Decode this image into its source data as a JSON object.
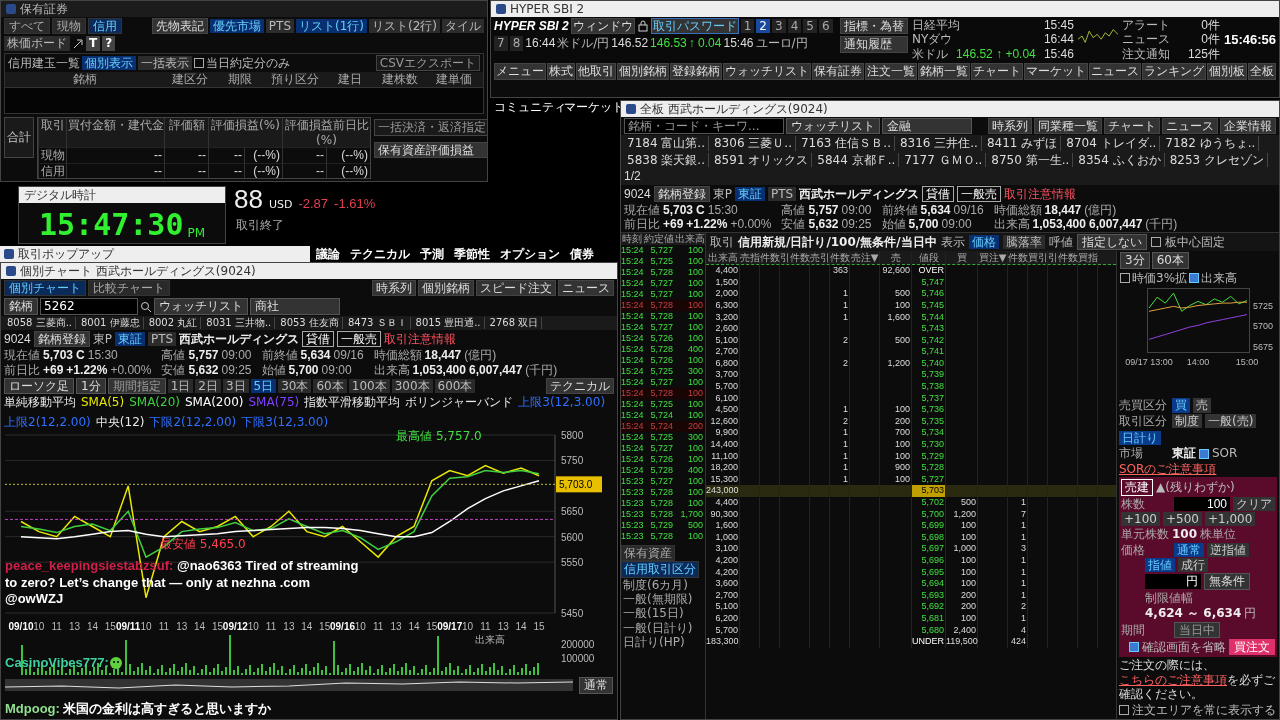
{
  "holdings_window": {
    "title": "保有証券",
    "tabs": [
      {
        "label": "すべて",
        "selected": false
      },
      {
        "label": "現物",
        "selected": false
      },
      {
        "label": "信用",
        "selected": true
      }
    ],
    "plain_buttons": [
      "先物表記"
    ],
    "market_toggle": [
      {
        "label": "優先市場",
        "selected": true
      },
      {
        "label": "PTS",
        "selected": false
      }
    ],
    "view_toggle": [
      {
        "label": "リスト(1行)",
        "selected": true
      },
      {
        "label": "リスト(2行)",
        "selected": false
      },
      {
        "label": "タイル",
        "selected": false
      },
      {
        "label": "株価ボード",
        "selected": false
      }
    ],
    "icon_chars": [
      "T",
      "?"
    ],
    "list_title": "信用建玉一覧",
    "display_toggle": [
      {
        "label": "個別表示",
        "selected": true
      },
      {
        "label": "一括表示",
        "selected": false
      }
    ],
    "today_only": {
      "label": "当日約定分のみ",
      "checked": false
    },
    "export_button": {
      "label": "CSVエクスポート",
      "disabled": true
    },
    "columns": [
      "銘柄",
      "建区分",
      "期限",
      "預り区分",
      "建日",
      "建株数",
      "建単価"
    ],
    "summary": {
      "label": "合計",
      "headers": [
        "取引",
        "買付金額・建代金",
        "評価額",
        "評価損益(%)",
        "評価損益前日比(%)"
      ],
      "rows": [
        {
          "name": "現物",
          "cells": [
            "--",
            "--",
            "--",
            "(--%)",
            "--",
            "(--%)"
          ]
        },
        {
          "name": "信用",
          "cells": [
            "--",
            "--",
            "--",
            "(--%)",
            "--",
            "(--%)"
          ]
        }
      ]
    },
    "side_buttons": [
      {
        "label": "一括決済・返済指定",
        "disabled": true
      },
      {
        "label": "保有資産評価損益",
        "disabled": false
      }
    ]
  },
  "main_bar": {
    "title": "HYPER SBI 2",
    "logo": "HYPER SBI 2",
    "window_menu": "ウィンドウ",
    "password_button": "取引パスワード",
    "workspaces": [
      {
        "label": "1",
        "selected": false
      },
      {
        "label": "2",
        "selected": true
      },
      {
        "label": "3",
        "selected": false
      },
      {
        "label": "4",
        "selected": false
      },
      {
        "label": "5",
        "selected": false
      },
      {
        "label": "6",
        "selected": false
      },
      {
        "label": "7",
        "selected": false
      },
      {
        "label": "8",
        "selected": false
      }
    ],
    "quotes": [
      {
        "texts": [
          "16:44"
        ]
      },
      {
        "name": "米ドル/円",
        "texts": [
          "146.52",
          "146.53",
          "↑ 0.04",
          "15:46"
        ]
      },
      {
        "name": "ユーロ/円"
      }
    ],
    "side_buttons": [
      "指標・為替",
      "通知履歴"
    ],
    "indices": [
      {
        "name": "日経平均",
        "time": "15:45"
      },
      {
        "name": "NYダウ",
        "time": "16:44"
      },
      {
        "name": "米ドル",
        "value": "146.52 ↑ +0.04",
        "time": "15:46"
      }
    ],
    "notices": [
      {
        "label": "アラート",
        "count": "0件"
      },
      {
        "label": "ニュース",
        "count": "0件"
      },
      {
        "label": "注文通知",
        "count": "125件"
      }
    ],
    "clock": "15:46:56",
    "menu": [
      "メニュー",
      "株式",
      "他取引",
      "個別銘柄",
      "登録銘柄",
      "ウォッチリスト",
      "保有証券",
      "注文一覧",
      "銘柄一覧",
      "チャート",
      "マーケット",
      "ニュース",
      "ランキング",
      "個別板",
      "全板"
    ]
  },
  "background": {
    "nav": [
      "コミュニティ",
      "マーケット"
    ],
    "price": "88",
    "currency": "USD",
    "change": "-2.87",
    "change_pct": "-1.61%",
    "status": "取引終了",
    "tabs": [
      "議論",
      "テクニカル",
      "予測",
      "季節性",
      "オプション",
      "債券"
    ]
  },
  "clock_window": {
    "title": "デジタル時計",
    "time": "15:47:30",
    "ampm": "PM"
  },
  "popup_window": {
    "title": "取引ポップアップ"
  },
  "chart_window": {
    "title": "個別チャート 西武ホールディングス(9024)",
    "tabs": [
      {
        "label": "個別チャート",
        "selected": true
      },
      {
        "label": "比較チャート",
        "selected": false
      }
    ],
    "buttons": [
      "時系列",
      "個別銘柄",
      "スピード注文",
      "ニュース"
    ],
    "search": {
      "type_select": "銘柄",
      "value": "5262",
      "watchlist": "ウォッチリスト",
      "list": "商社"
    },
    "tickers": [
      "8058 三菱商..",
      "8001 伊藤忠",
      "8002 丸紅",
      "8031 三井物..",
      "8053 住友商",
      "8473 ＳＢＩ",
      "8015 豊田通..",
      "2768 双日"
    ],
    "info": {
      "code": "9024",
      "register": "銘柄登録",
      "market": "東P",
      "name": "西武ホールディングス",
      "venues": [
        {
          "label": "東証",
          "selected": true
        },
        {
          "label": "PTS",
          "selected": false
        }
      ],
      "tags": [
        "貸借",
        "一般売"
      ],
      "warning": "取引注意情報",
      "fields": [
        {
          "label": "現在値",
          "value": "5,703",
          "extra": "C",
          "time": "15:30"
        },
        {
          "label": "前日比",
          "value": "+69",
          "extra": "+1.22%",
          "time": "+0.00%"
        },
        {
          "label": "高値",
          "value": "5,757",
          "time": "09:00"
        },
        {
          "label": "安値",
          "value": "5,632",
          "time": "09:25"
        },
        {
          "label": "前終値",
          "value": "5,634",
          "time": "09/16"
        },
        {
          "label": "始値",
          "value": "5,700",
          "time": "09:00"
        },
        {
          "label": "時価総額",
          "value": "18,447",
          "time": "(億円)"
        },
        {
          "label": "出来高",
          "value": "1,053,400",
          "extra": "6,007,447",
          "time": "(千円)"
        }
      ]
    },
    "controls": {
      "chart_type": "ローソク足",
      "interval": "1分",
      "range": "期間指定",
      "periods": [
        {
          "label": "1日",
          "selected": false
        },
        {
          "label": "2日",
          "selected": false
        },
        {
          "label": "3日",
          "selected": false
        },
        {
          "label": "5日",
          "selected": true
        },
        {
          "label": "30本",
          "selected": false
        },
        {
          "label": "60本",
          "selected": false
        },
        {
          "label": "100本",
          "selected": false
        },
        {
          "label": "300本",
          "selected": false
        },
        {
          "label": "600本",
          "selected": false
        }
      ],
      "technical": "テクニカル"
    },
    "legend": [
      {
        "label": "単純移動平均"
      },
      {
        "label": "SMA(75)",
        "color": "#8040ff"
      },
      {
        "label": "指数平滑移動平均"
      },
      {
        "label": "ボリンジャーバンド"
      },
      {
        "label": "上限3(12,3.00)",
        "color": "#3070ff"
      },
      {
        "label": "上限2(12,2.00)",
        "color": "#3070ff"
      },
      {
        "label": "中央(12)"
      },
      {
        "label": "下限2(12,2.00)",
        "color": "#3070ff"
      },
      {
        "label": "下限3(12,3.00)",
        "color": "#3070ff"
      }
    ],
    "annotations": {
      "high": "最高値 5,757.0",
      "price_tag": "5,703.0",
      "low": "最安値 5,465.0"
    },
    "chart_data": {
      "type": "line",
      "grid": true,
      "categories": [
        "09/10",
        "10",
        "11",
        "13",
        "14",
        "15",
        "09/11",
        "10",
        "11",
        "13",
        "14",
        "15",
        "09/12",
        "10",
        "11",
        "13",
        "14",
        "15",
        "09/16",
        "10",
        "11",
        "13",
        "14",
        "15",
        "09/17",
        "10",
        "11",
        "13",
        "14",
        "15"
      ],
      "ylim": [
        5450,
        5800
      ],
      "yticks": [
        5450,
        5550,
        5600,
        5650,
        5750,
        5800
      ],
      "series": [
        {
          "name": "SMA(5)",
          "color": "#e8e800",
          "values": [
            5630,
            5610,
            5600,
            5640,
            5620,
            5600,
            5700,
            5480,
            5600,
            5630,
            5610,
            5620,
            5640,
            5600,
            5620,
            5650,
            5610,
            5600,
            5620,
            5590,
            5560,
            5600,
            5620,
            5710,
            5730,
            5720,
            5740,
            5725,
            5735,
            5720
          ]
        },
        {
          "name": "SMA(20)",
          "color": "#40d040",
          "values": [
            5620,
            5615,
            5608,
            5620,
            5625,
            5612,
            5650,
            5560,
            5580,
            5610,
            5615,
            5618,
            5628,
            5612,
            5616,
            5635,
            5620,
            5606,
            5612,
            5598,
            5575,
            5590,
            5610,
            5680,
            5715,
            5718,
            5730,
            5726,
            5730,
            5724
          ]
        },
        {
          "name": "SMA(200)",
          "color": "#ffffff",
          "values": [
            5600,
            5598,
            5596,
            5600,
            5605,
            5610,
            5612,
            5605,
            5600,
            5602,
            5604,
            5606,
            5610,
            5612,
            5614,
            5616,
            5618,
            5618,
            5616,
            5612,
            5606,
            5600,
            5600,
            5608,
            5630,
            5655,
            5675,
            5690,
            5700,
            5710
          ]
        }
      ]
    },
    "volume": {
      "label": "出来高",
      "ticks": [
        "200000",
        "100000"
      ]
    },
    "display_select": "通常"
  },
  "chat": [
    {
      "kind": "text",
      "user": "peace_keepingsiestabzsuf:",
      "color": "#d0204a",
      "text": "@nao6363 Tired of streaming to zero? Let’s change that — only at nezhna .com @owWZJ"
    },
    {
      "kind": "emote",
      "user": "CasinoVibes777:",
      "color": "#40d0a0"
    },
    {
      "kind": "text",
      "user": "Mdpoog:",
      "color": "#90e090",
      "text": "米国の金利は高すぎると思いますか"
    }
  ],
  "board_window": {
    "title": "全板 西武ホールディングス(9024)",
    "search": {
      "placeholder": "銘柄・コード・キーワ...",
      "watchlist": "ウォッチリスト",
      "list": "金融"
    },
    "buttons": [
      "時系列",
      "同業種一覧",
      "チャート",
      "ニュース",
      "企業情報"
    ],
    "tickers": [
      "7184 富山第..",
      "8306 三菱Ｕ..",
      "7163 住信ＳＢ..",
      "8316 三井住..",
      "8411 みずほ",
      "8704 トレイダ..",
      "7182 ゆうちょ..",
      "5838 楽天銀..",
      "8591 オリックス",
      "5844 京都Ｆ..",
      "7177 ＧＭＯ..",
      "8750 第一生..",
      "8354 ふくおか",
      "8253 クレセゾン"
    ],
    "page": "1/2",
    "info": {
      "code": "9024",
      "register": "銘柄登録",
      "market": "東P",
      "name": "西武ホールディングス",
      "venues": [
        {
          "label": "東証",
          "selected": true
        },
        {
          "label": "PTS",
          "selected": false
        }
      ],
      "tags": [
        "貸借",
        "一般売"
      ],
      "warning": "取引注意情報",
      "fields": [
        {
          "label": "現在値",
          "value": "5,703",
          "extra": "C",
          "time": "15:30"
        },
        {
          "label": "前日比",
          "value": "+69",
          "extra": "+1.22%",
          "time": "+0.00%"
        },
        {
          "label": "高値",
          "value": "5,757",
          "time": "09:00"
        },
        {
          "label": "安値",
          "value": "5,632",
          "time": "09:25"
        },
        {
          "label": "前終値",
          "value": "5,634",
          "time": "09/16"
        },
        {
          "label": "始値",
          "value": "5,700",
          "time": "09:00"
        },
        {
          "label": "時価総額",
          "value": "18,447",
          "time": "(億円)"
        },
        {
          "label": "出来高",
          "value": "1,053,400",
          "extra": "6,007,447",
          "time": "(千円)"
        }
      ]
    },
    "order_bar": {
      "trade_label": "取引",
      "trade": "信用新規/日計り/100/無条件/当日中",
      "display_label": "表示",
      "display": [
        {
          "label": "価格",
          "selected": true
        },
        {
          "label": "騰落率",
          "selected": false
        }
      ],
      "tick_label": "呼値",
      "tick": "指定しない",
      "center_fix": {
        "label": "板中心固定",
        "checked": false
      }
    },
    "ticks_headers": [
      "時刻",
      "約定値",
      "出来高"
    ],
    "ticks": [
      {
        "time": "15:24",
        "price": "5,727",
        "qty": "100",
        "dimmed": false
      },
      {
        "time": "15:24",
        "price": "5,725",
        "qty": "100",
        "dimmed": false
      },
      {
        "time": "15:24",
        "price": "5,728",
        "qty": "100",
        "dimmed": false
      },
      {
        "time": "15:24",
        "price": "5,727",
        "qty": "100",
        "dimmed": false
      },
      {
        "time": "15:24",
        "price": "5,727",
        "qty": "100",
        "dimmed": false
      },
      {
        "time": "15:24",
        "price": "5,728",
        "qty": "100",
        "dimmed": true
      },
      {
        "time": "15:24",
        "price": "5,728",
        "qty": "100",
        "dimmed": false
      },
      {
        "time": "15:24",
        "price": "5,727",
        "qty": "100",
        "dimmed": false
      },
      {
        "time": "15:24",
        "price": "5,726",
        "qty": "100",
        "dimmed": false
      },
      {
        "time": "15:24",
        "price": "5,728",
        "qty": "400",
        "dimmed": false
      },
      {
        "time": "15:24",
        "price": "5,726",
        "qty": "100",
        "dimmed": false
      },
      {
        "time": "15:24",
        "price": "5,725",
        "qty": "300",
        "dimmed": false
      },
      {
        "time": "15:24",
        "price": "5,727",
        "qty": "100",
        "dimmed": false
      },
      {
        "time": "15:24",
        "price": "5,728",
        "qty": "100",
        "dimmed": true
      },
      {
        "time": "15:24",
        "price": "5,725",
        "qty": "100",
        "dimmed": false
      },
      {
        "time": "15:24",
        "price": "5,724",
        "qty": "100",
        "dimmed": false
      },
      {
        "time": "15:24",
        "price": "5,724",
        "qty": "200",
        "dimmed": true
      },
      {
        "time": "15:24",
        "price": "5,725",
        "qty": "300",
        "dimmed": false
      },
      {
        "time": "15:24",
        "price": "5,727",
        "qty": "100",
        "dimmed": false
      },
      {
        "time": "15:24",
        "price": "5,726",
        "qty": "100",
        "dimmed": false
      },
      {
        "time": "15:24",
        "price": "5,728",
        "qty": "400",
        "dimmed": false
      },
      {
        "time": "15:23",
        "price": "5,727",
        "qty": "100",
        "dimmed": false
      },
      {
        "time": "15:23",
        "price": "5,728",
        "qty": "100",
        "dimmed": false
      },
      {
        "time": "15:23",
        "price": "5,728",
        "qty": "100",
        "dimmed": false
      },
      {
        "time": "15:23",
        "price": "5,728",
        "qty": "1,700",
        "dimmed": false
      },
      {
        "time": "15:23",
        "price": "5,729",
        "qty": "500",
        "dimmed": false
      },
      {
        "time": "15:23",
        "price": "5,728",
        "qty": "100",
        "dimmed": false
      }
    ],
    "bottom_tabs": [
      {
        "label": "保有資産",
        "selected": false
      },
      {
        "label": "信用取引区分",
        "selected": true
      }
    ],
    "credit_types": [
      "制度(6カ月)",
      "一般(無期限)",
      "一般(15日)",
      "一般(日計り)",
      "日計り(HP)"
    ],
    "board_headers": [
      "出来高",
      "売指",
      "件数",
      "引件数",
      "売引",
      "件数",
      "売注▼",
      "売",
      "値段",
      "買",
      "買注▼",
      "件数",
      "買引",
      "引件数",
      "買指"
    ],
    "board": [
      {
        "kind": "over",
        "vol": "4,400",
        "count": "363",
        "qty": "92,600",
        "price": "OVER"
      },
      {
        "kind": "sell",
        "vol": "1,500",
        "price": "5,747"
      },
      {
        "kind": "sell",
        "vol": "2,000",
        "count": "1",
        "qty": "500",
        "price": "5,746"
      },
      {
        "kind": "sell",
        "vol": "6,300",
        "count": "1",
        "qty": "100",
        "price": "5,745"
      },
      {
        "kind": "sell",
        "vol": "3,200",
        "count": "1",
        "qty": "1,600",
        "price": "5,744"
      },
      {
        "kind": "sell",
        "vol": "2,600",
        "price": "5,743"
      },
      {
        "kind": "sell",
        "vol": "5,100",
        "count": "2",
        "qty": "500",
        "price": "5,742"
      },
      {
        "kind": "sell",
        "vol": "2,700",
        "price": "5,741"
      },
      {
        "kind": "sell",
        "vol": "6,800",
        "count": "2",
        "qty": "1,200",
        "price": "5,740"
      },
      {
        "kind": "sell",
        "vol": "3,700",
        "price": "5,739"
      },
      {
        "kind": "sell",
        "vol": "5,700",
        "price": "5,738"
      },
      {
        "kind": "sell",
        "vol": "6,100",
        "price": "5,737"
      },
      {
        "kind": "sell",
        "vol": "4,500",
        "count": "1",
        "qty": "100",
        "price": "5,736"
      },
      {
        "kind": "sell",
        "vol": "12,600",
        "count": "2",
        "qty": "200",
        "price": "5,735"
      },
      {
        "kind": "sell",
        "vol": "9,900",
        "count": "1",
        "qty": "700",
        "price": "5,734"
      },
      {
        "kind": "sell",
        "vol": "14,400",
        "count": "1",
        "qty": "100",
        "price": "5,730"
      },
      {
        "kind": "sell",
        "vol": "11,100",
        "count": "1",
        "qty": "100",
        "price": "5,729"
      },
      {
        "kind": "sell",
        "vol": "18,200",
        "count": "1",
        "qty": "900",
        "price": "5,728"
      },
      {
        "kind": "sell",
        "vol": "15,300",
        "count": "1",
        "qty": "100",
        "price": "5,727"
      },
      {
        "kind": "current",
        "vol": "243,000",
        "price": "5,703"
      },
      {
        "kind": "buy",
        "vol": "4,400",
        "count": "1",
        "qty": "500",
        "price": "5,702"
      },
      {
        "kind": "buy",
        "vol": "90,300",
        "count": "7",
        "qty": "1,200",
        "price": "5,700"
      },
      {
        "kind": "buy",
        "vol": "1,600",
        "count": "1",
        "qty": "100",
        "price": "5,699"
      },
      {
        "kind": "buy",
        "vol": "1,000",
        "count": "1",
        "qty": "100",
        "price": "5,698"
      },
      {
        "kind": "buy",
        "vol": "3,100",
        "count": "3",
        "qty": "1,000",
        "price": "5,697"
      },
      {
        "kind": "buy",
        "vol": "4,200",
        "count": "1",
        "qty": "100",
        "price": "5,696"
      },
      {
        "kind": "buy",
        "vol": "4,200",
        "count": "1",
        "qty": "100",
        "price": "5,695"
      },
      {
        "kind": "buy",
        "vol": "3,600",
        "count": "1",
        "qty": "100",
        "price": "5,694"
      },
      {
        "kind": "buy",
        "vol": "2,700",
        "count": "1",
        "qty": "200",
        "price": "5,693"
      },
      {
        "kind": "buy",
        "vol": "5,100",
        "count": "2",
        "qty": "200",
        "price": "5,692"
      },
      {
        "kind": "buy",
        "vol": "6,200",
        "count": "1",
        "qty": "100",
        "price": "5,681"
      },
      {
        "kind": "buy",
        "vol": "5,700",
        "count": "4",
        "qty": "2,400",
        "price": "5,680"
      },
      {
        "kind": "under",
        "vol": "183,300",
        "count": "424",
        "qty": "119,500",
        "price": "UNDER"
      }
    ],
    "mini_chart": {
      "interval": "3分",
      "bars": "60本",
      "expand": {
        "label": "時価3%拡",
        "checked": false
      },
      "volume": {
        "label": "出来高",
        "checked": true
      },
      "chart_data": {
        "type": "line",
        "categories": [
          "09/17 13:00",
          null,
          null,
          null,
          null,
          null,
          "14:00",
          null,
          null,
          null,
          null,
          null,
          "15:00"
        ],
        "ylim": [
          5670,
          5745
        ],
        "yticks": [
          5675,
          5700,
          5725
        ],
        "series": [
          {
            "color": "#40e040",
            "values": [
              5722,
              5735,
              5728,
              5740,
              5718,
              5725,
              5730,
              5726,
              5733,
              5729,
              5736,
              5727,
              5731
            ]
          },
          {
            "color": "#e0a040",
            "values": [
              5718,
              5720,
              5722,
              5724,
              5722,
              5723,
              5725,
              5726,
              5727,
              5728,
              5728,
              5729,
              5729
            ]
          },
          {
            "color": "#9040e0",
            "values": [
              5684,
              5687,
              5690,
              5693,
              5696,
              5699,
              5701,
              5704,
              5706,
              5708,
              5710,
              5712,
              5714
            ]
          }
        ]
      }
    },
    "order": {
      "side_label": "売買区分",
      "sides": [
        {
          "label": "買",
          "selected": true
        },
        {
          "label": "売",
          "selected": false
        }
      ],
      "type_label": "取引区分",
      "types": [
        {
          "label": "制度",
          "selected": false
        },
        {
          "label": "一般(売)",
          "selected": false
        },
        {
          "label": "日計り",
          "selected": true
        }
      ],
      "market_label": "市場",
      "market": "東証",
      "sor": {
        "label": "SOR",
        "checked": true
      },
      "sor_link": "SORのご注意事項",
      "tag": "売建",
      "tag_note": "▲(残りわずか)",
      "qty_label": "株数",
      "qty": "100",
      "clear": "クリア",
      "increments": [
        "+100",
        "+500",
        "+1,000"
      ],
      "unit_label": "単元株数",
      "unit": "100",
      "unit_suffix": "株単位",
      "price_label": "価格",
      "price_modes": [
        {
          "label": "通常",
          "selected": true
        },
        {
          "label": "逆指値",
          "selected": false
        }
      ],
      "price_types": [
        {
          "label": "指値",
          "selected": true
        },
        {
          "label": "成行",
          "selected": false
        }
      ],
      "yen": "円",
      "condition": "無条件",
      "limit_label": "制限値幅",
      "limit": "4,624 ～ 6,634",
      "limit_unit": "円",
      "period_label": "期間",
      "period": "当日中",
      "skip_confirm": {
        "label": "確認画面を省略",
        "checked": true
      },
      "submit": "買注文",
      "note_pre": "ご注文の際には、",
      "note_link": "こちらのご注意事項",
      "note_post": "を必ずご確認ください。",
      "always_show": {
        "label": "注文エリアを常に表示する",
        "checked": false
      }
    }
  }
}
